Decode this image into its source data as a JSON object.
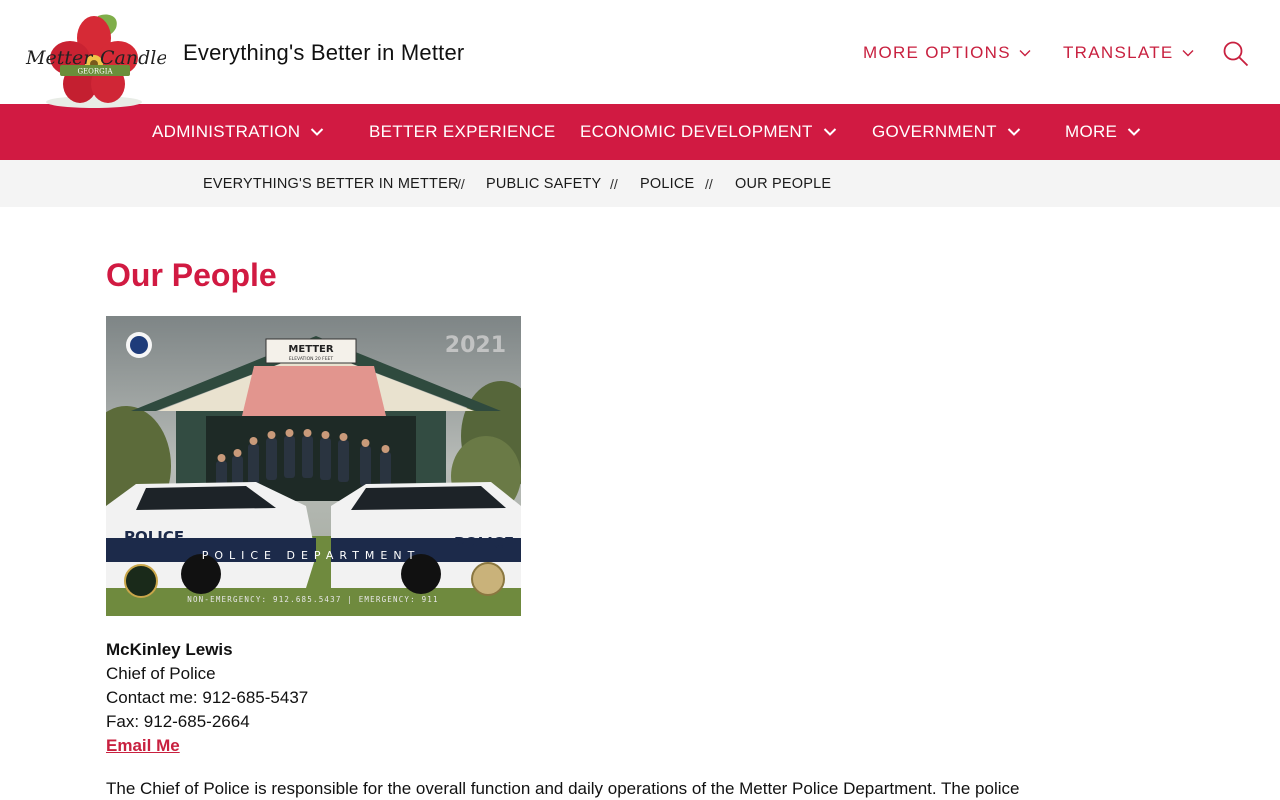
{
  "header": {
    "site_title": "Everything's Better in Metter",
    "logo": {
      "line1": "Metter",
      "line2": "Candler",
      "line3": "GEORGIA"
    },
    "more_options": "MORE OPTIONS",
    "translate": "TRANSLATE"
  },
  "nav": {
    "items": [
      {
        "label": "ADMINISTRATION",
        "dropdown": true
      },
      {
        "label": "BETTER EXPERIENCE",
        "dropdown": false
      },
      {
        "label": "ECONOMIC DEVELOPMENT",
        "dropdown": true
      },
      {
        "label": "GOVERNMENT",
        "dropdown": true
      },
      {
        "label": "MORE",
        "dropdown": true
      }
    ]
  },
  "breadcrumb": {
    "items": [
      "EVERYTHING'S BETTER IN METTER",
      "PUBLIC SAFETY",
      "POLICE",
      "OUR PEOPLE"
    ],
    "separator": "//"
  },
  "main": {
    "title": "Our People",
    "photo": {
      "year": "2021",
      "sign_title": "METTER",
      "sign_sub": "ELEVATION 20 FEET",
      "car_label": "POLICE",
      "dept_label": "POLICE DEPARTMENT",
      "footer": "NON-EMERGENCY: 912.685.5437  |  EMERGENCY: 911"
    },
    "contact": {
      "name": "McKinley Lewis",
      "role": "Chief of Police",
      "phone": "Contact me: 912-685-5437",
      "fax": "Fax: 912-685-2664",
      "email_label": "Email Me"
    },
    "paragraph": "The Chief of Police is responsible for the overall function and daily operations of the Metter Police Department.  The police"
  },
  "colors": {
    "brand_red": "#d11a42",
    "link_red": "#c8203f",
    "breadcrumb_bg": "#f4f4f4"
  },
  "icons": {
    "search": "search-icon",
    "chevron": "chevron-down-icon"
  }
}
